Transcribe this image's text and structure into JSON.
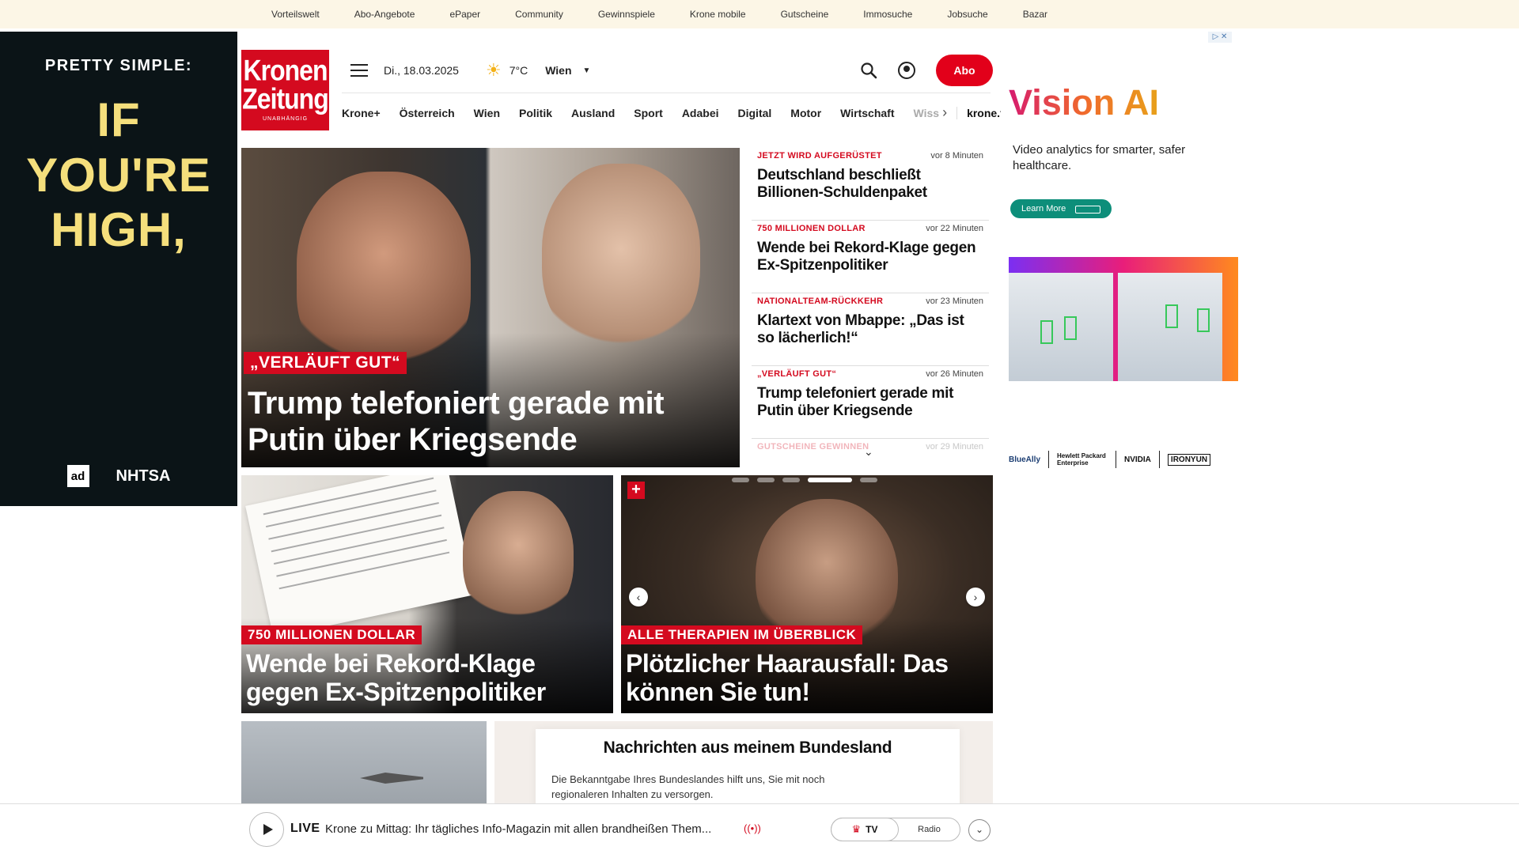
{
  "topbar": [
    "Vorteilswelt",
    "Abo-Angebote",
    "ePaper",
    "Community",
    "Gewinnspiele",
    "Krone mobile",
    "Gutscheine",
    "Immosuche",
    "Jobsuche",
    "Bazar"
  ],
  "left_ad": {
    "tag": "PRETTY SIMPLE:",
    "big": [
      "IF",
      "YOU'RE",
      "HIGH,"
    ],
    "logo1": "ad",
    "logo2": "NHTSA"
  },
  "logo": {
    "line1": "Kronen",
    "line2": "Zeitung",
    "sub": "UNABHÄNGIG"
  },
  "header": {
    "date": "Di., 18.03.2025",
    "temp": "7°C",
    "city": "Wien",
    "abo": "Abo"
  },
  "nav": [
    "Krone+",
    "Österreich",
    "Wien",
    "Politik",
    "Ausland",
    "Sport",
    "Adabei",
    "Digital",
    "Motor",
    "Wirtschaft"
  ],
  "nav_cut": "Wiss",
  "nav_tv": "krone.tv",
  "hero": {
    "kicker": "„VERLÄUFT GUT“",
    "title": "Trump telefoniert gerade mit Putin über Kriegsende"
  },
  "news": [
    {
      "kicker": "JETZT WIRD AUFGERÜSTET",
      "time": "vor 8 Minuten",
      "head": "Deutschland beschließt Billionen-Schuldenpaket"
    },
    {
      "kicker": "750 MILLIONEN DOLLAR",
      "time": "vor 22 Minuten",
      "head": "Wende bei Rekord-Klage gegen Ex-Spitzenpolitiker"
    },
    {
      "kicker": "NATIONALTEAM-RÜCKKEHR",
      "time": "vor 23 Minuten",
      "head": "Klartext von Mbappe: „Das ist so lächerlich!“"
    },
    {
      "kicker": "„VERLÄUFT GUT“",
      "time": "vor 26 Minuten",
      "head": "Trump telefoniert gerade mit Putin über Kriegsende"
    },
    {
      "kicker": "GUTSCHEINE GEWINNEN",
      "time": "vor 29 Minuten",
      "head": ""
    }
  ],
  "card1": {
    "kicker": "750 MILLIONEN DOLLAR",
    "title": "Wende bei Rekord-Klage gegen Ex-Spitzenpolitiker"
  },
  "card2": {
    "kicker": "ALLE THERAPIEN IM ÜBERBLICK",
    "title": "Plötzlicher Haarausfall: Das können Sie tun!"
  },
  "bundesland": {
    "title": "Nachrichten aus meinem Bundesland",
    "desc": "Die Bekanntgabe Ihres Bundeslandes hilft uns, Sie mit noch regionaleren Inhalten zu versorgen."
  },
  "right_ad": {
    "title": "Vision AI",
    "sub": "Video analytics for smarter, safer healthcare.",
    "cta": "Learn More",
    "logos": [
      "BlueAlly",
      "Hewlett Packard Enterprise",
      "NVIDIA",
      "IRONYUN"
    ]
  },
  "live": {
    "label": "LIVE",
    "text": "Krone zu Mittag: Ihr tägliches Info-Magazin mit allen brandheißen Them...",
    "tv": "TV",
    "radio": "Radio"
  }
}
